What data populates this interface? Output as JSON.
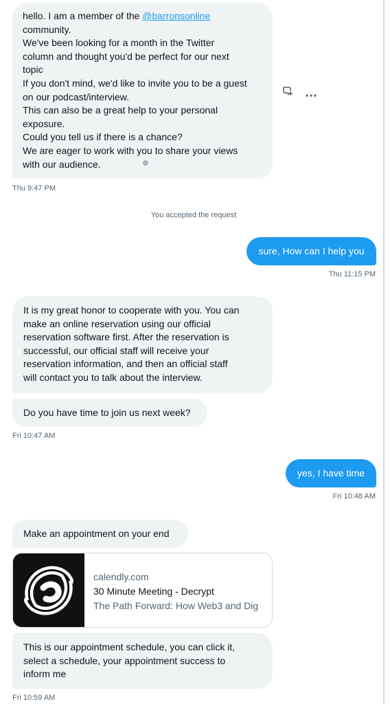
{
  "messages": {
    "m1": {
      "line1_prefix": "hello. I am a member of the ",
      "mention": "@barronsonline",
      "lines": [
        "community.",
        "We've been looking for a month in the Twitter",
        "column and thought you'd be perfect for our next",
        "topic",
        "If you don't mind, we'd like to invite you to be a guest",
        "on our podcast/interview.",
        "This can also be a great help to your personal",
        "exposure.",
        "Could you tell us if there is a chance?",
        "We are eager to work with you to share your views",
        "with our audience."
      ],
      "time": "Thu 9:47 PM"
    },
    "system_notice": "You accepted the request",
    "m2": {
      "text": "sure, How can I help you",
      "time": "Thu 11:15 PM"
    },
    "m3": {
      "lines": [
        "It is my great honor to cooperate with you. You can",
        "make an online reservation using our official",
        "reservation software first. After the reservation is",
        "successful, our official staff will receive your",
        "reservation information, and then an official staff",
        "will contact you to talk about the interview."
      ]
    },
    "m4": {
      "text": "Do you have time to join us next week?",
      "time": "Fri 10:47 AM"
    },
    "m5": {
      "text": "yes, I have time",
      "time": "Fri 10:48 AM"
    },
    "m6": {
      "text": "Make an appointment on your end"
    },
    "link_card": {
      "domain": "calendly.com",
      "title": "30 Minute Meeting - Decrypt",
      "description": "The Path Forward: How Web3 and Dig"
    },
    "m7": {
      "lines": [
        "This is our appointment schedule, you can click it,",
        "select a schedule, your appointment success to",
        "inform me"
      ],
      "time": "Fri 10:59 AM"
    }
  },
  "icons": {
    "react": "add-reaction-icon",
    "more": "more-options-icon",
    "thumbnail": "decrypt-logo-icon"
  },
  "colors": {
    "accent": "#1d9bf0",
    "incoming_bubble": "#eff3f4",
    "muted_text": "#536471"
  }
}
